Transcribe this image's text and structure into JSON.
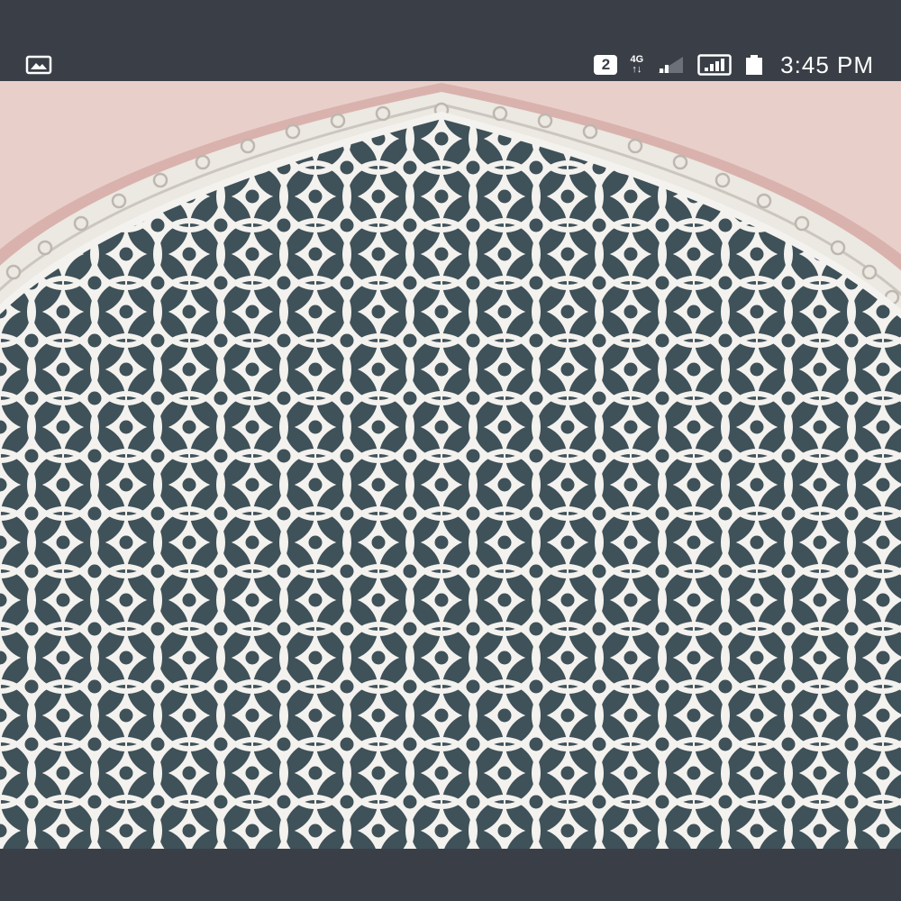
{
  "status_bar": {
    "notification_icon": "image-icon",
    "sim_badge": "2",
    "network_type_top": "4G",
    "network_arrows": "↑↓",
    "signal_icon": "signal-icon",
    "battery_icon": "battery-icon",
    "time": "3:45 PM"
  },
  "viewer": {
    "image_subject": "lattice-window-icon"
  },
  "colors": {
    "bar_background": "#3a3f47",
    "wall_pink": "#e9cfca",
    "lattice_white": "#f4f2ee",
    "glass_dark": "#3f5159"
  }
}
